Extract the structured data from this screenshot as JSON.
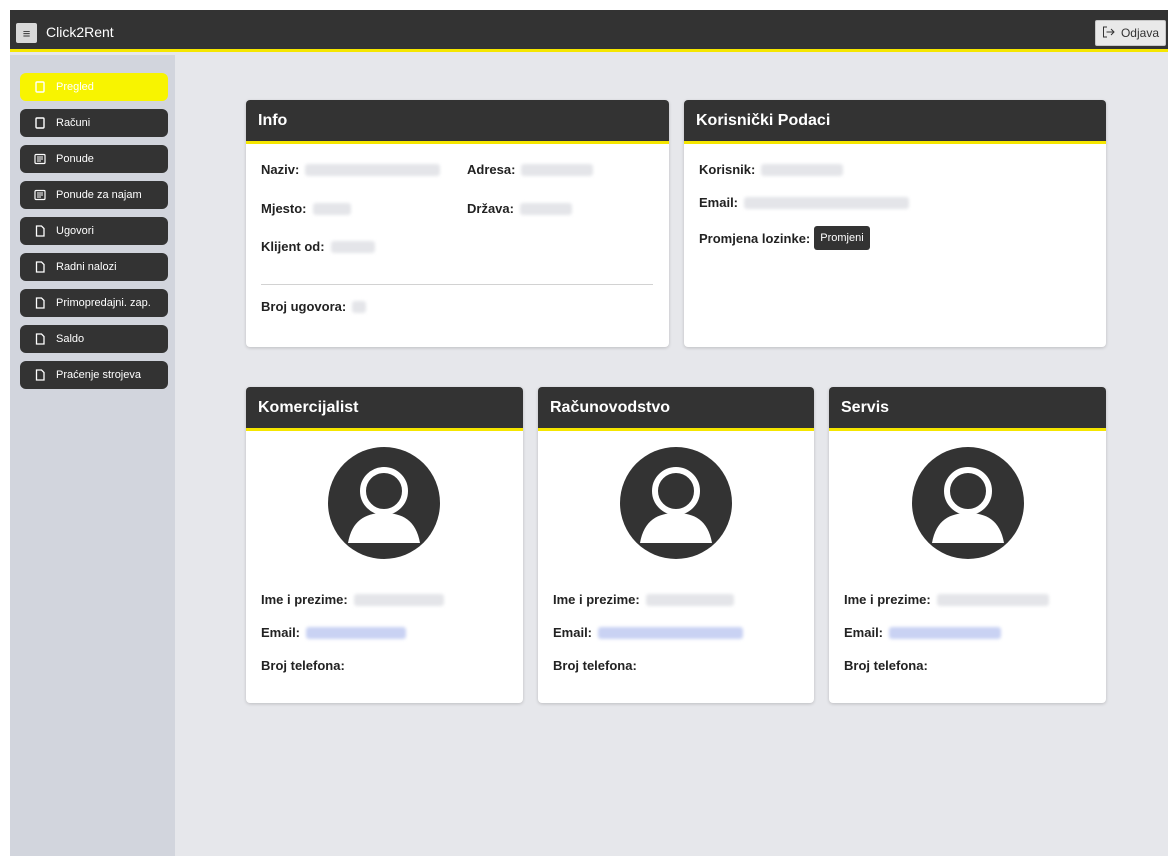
{
  "header": {
    "app_title": "Click2Rent",
    "logout_label": "Odjava"
  },
  "sidebar": {
    "items": [
      {
        "label": "Pregled",
        "icon": "document-icon",
        "active": true
      },
      {
        "label": "Računi",
        "icon": "document-icon"
      },
      {
        "label": "Ponude",
        "icon": "offer-icon"
      },
      {
        "label": "Ponude za najam",
        "icon": "offer-icon"
      },
      {
        "label": "Ugovori",
        "icon": "file-icon"
      },
      {
        "label": "Radni nalozi",
        "icon": "file-icon"
      },
      {
        "label": "Primopredajni. zap.",
        "icon": "file-icon"
      },
      {
        "label": "Saldo",
        "icon": "file-icon"
      },
      {
        "label": "Praćenje strojeva",
        "icon": "file-icon"
      }
    ]
  },
  "info": {
    "title": "Info",
    "naziv_label": "Naziv:",
    "adresa_label": "Adresa:",
    "mjesto_label": "Mjesto:",
    "drzava_label": "Država:",
    "klijent_od_label": "Klijent od:",
    "broj_ugovora_label": "Broj ugovora:"
  },
  "user": {
    "title": "Korisnički Podaci",
    "korisnik_label": "Korisnik:",
    "email_label": "Email:",
    "password_label": "Promjena lozinke:",
    "change_button": "Promjeni"
  },
  "contacts": [
    {
      "title": "Komercijalist",
      "name_label": "Ime i prezime:",
      "email_label": "Email:",
      "phone_label": "Broj telefona:"
    },
    {
      "title": "Računovodstvo",
      "name_label": "Ime i prezime:",
      "email_label": "Email:",
      "phone_label": "Broj telefona:"
    },
    {
      "title": "Servis",
      "name_label": "Ime i prezime:",
      "email_label": "Email:",
      "phone_label": "Broj telefona:"
    }
  ],
  "colors": {
    "accent": "#f5e600",
    "dark": "#333333",
    "background": "#e6e7eb"
  }
}
